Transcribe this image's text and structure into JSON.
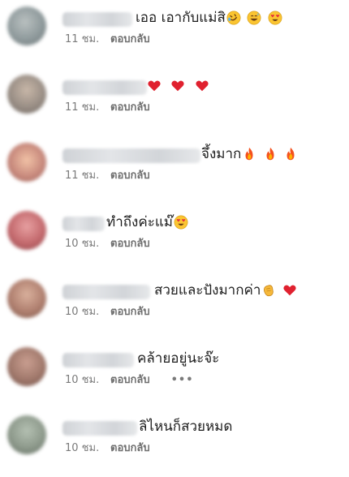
{
  "comments": [
    {
      "text": "เออ เอากับแม่สิ",
      "emojis": [
        "rofl-emoji",
        "grinning-sweat-emoji",
        "heart-eyes-emoji"
      ],
      "time": "11 ชม.",
      "reply": "ตอบกลับ",
      "avatar_color": "#8f9a9c"
    },
    {
      "text": "",
      "emojis": [
        "red-heart-emoji",
        "red-heart-emoji",
        "red-heart-emoji"
      ],
      "time": "11 ชม.",
      "reply": "ตอบกลับ",
      "avatar_color": "#9a8f86"
    },
    {
      "text": "จึ้งมาก",
      "emojis": [
        "fire-emoji",
        "fire-emoji",
        "fire-emoji"
      ],
      "time": "11 ชม.",
      "reply": "ตอบกลับ",
      "avatar_color": "#c98b7e"
    },
    {
      "text": "ทำถึงค่ะแม๊",
      "emojis": [
        "heart-eyes-emoji"
      ],
      "time": "10 ชม.",
      "reply": "ตอบกลับ",
      "avatar_color": "#c46a6e"
    },
    {
      "text": "สวยและปังมากค่า",
      "emojis": [
        "clapping-emoji",
        "red-heart-emoji"
      ],
      "time": "10 ชม.",
      "reply": "ตอบกลับ",
      "avatar_color": "#b08070"
    },
    {
      "text": "คล้ายอยู่นะจ๊ะ",
      "emojis": [],
      "time": "10 ชม.",
      "reply": "ตอบกลับ",
      "more": "•••",
      "avatar_color": "#a1796c"
    },
    {
      "text": "ลิไหนก็สวยหมด",
      "emojis": [],
      "time": "10 ชม.",
      "reply": "ตอบกลับ",
      "avatar_color": "#8e9a8c"
    }
  ]
}
